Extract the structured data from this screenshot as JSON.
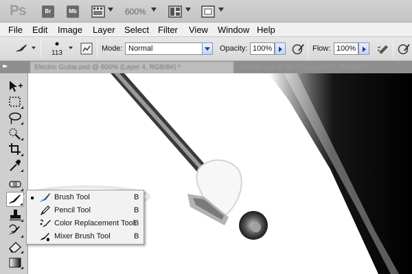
{
  "app": {
    "logo": "Ps",
    "bridge_label": "Br",
    "minibridge_label": "Mb",
    "zoom": "600%"
  },
  "menu": [
    "File",
    "Edit",
    "Image",
    "Layer",
    "Select",
    "Filter",
    "View",
    "Window",
    "Help"
  ],
  "options": {
    "brush_size": "113",
    "mode_label": "Mode:",
    "mode_value": "Normal",
    "opacity_label": "Opacity:",
    "opacity_value": "100%",
    "flow_label": "Flow:",
    "flow_value": "100%"
  },
  "tabs": {
    "active": "Electric Guitar.psd @ 600% (Layer 4, RGB/8#) *",
    "inactive": "5603KI.psd @ 66.7% (Layer 12, RGB/8) *"
  },
  "tools": [
    {
      "name": "move-tool",
      "icon": "move-icon"
    },
    {
      "name": "marquee-tool",
      "icon": "marquee-icon"
    },
    {
      "name": "lasso-tool",
      "icon": "lasso-icon"
    },
    {
      "name": "quick-selection-tool",
      "icon": "quick-selection-icon"
    },
    {
      "name": "crop-tool",
      "icon": "crop-icon"
    },
    {
      "name": "eyedropper-tool",
      "icon": "eyedropper-icon"
    },
    {
      "name": "spot-healing-tool",
      "icon": "bandage-icon"
    },
    {
      "name": "brush-tool",
      "icon": "brush-icon",
      "active": true
    },
    {
      "name": "clone-stamp-tool",
      "icon": "stamp-icon"
    },
    {
      "name": "history-brush-tool",
      "icon": "history-brush-icon"
    },
    {
      "name": "eraser-tool",
      "icon": "eraser-icon"
    },
    {
      "name": "gradient-tool",
      "icon": "gradient-icon"
    }
  ],
  "flyout": {
    "items": [
      {
        "label": "Brush Tool",
        "shortcut": "B",
        "icon": "brush-icon",
        "selected": true
      },
      {
        "label": "Pencil Tool",
        "shortcut": "B",
        "icon": "pencil-icon"
      },
      {
        "label": "Color Replacement Tool",
        "shortcut": "B",
        "icon": "color-replacement-icon"
      },
      {
        "label": "Mixer Brush Tool",
        "shortcut": "B",
        "icon": "mixer-brush-icon"
      }
    ]
  },
  "colors": {
    "accent": "#1d3f8e",
    "canvas_bg": "#ffffff",
    "panel_bg": "#cfcfcf"
  }
}
